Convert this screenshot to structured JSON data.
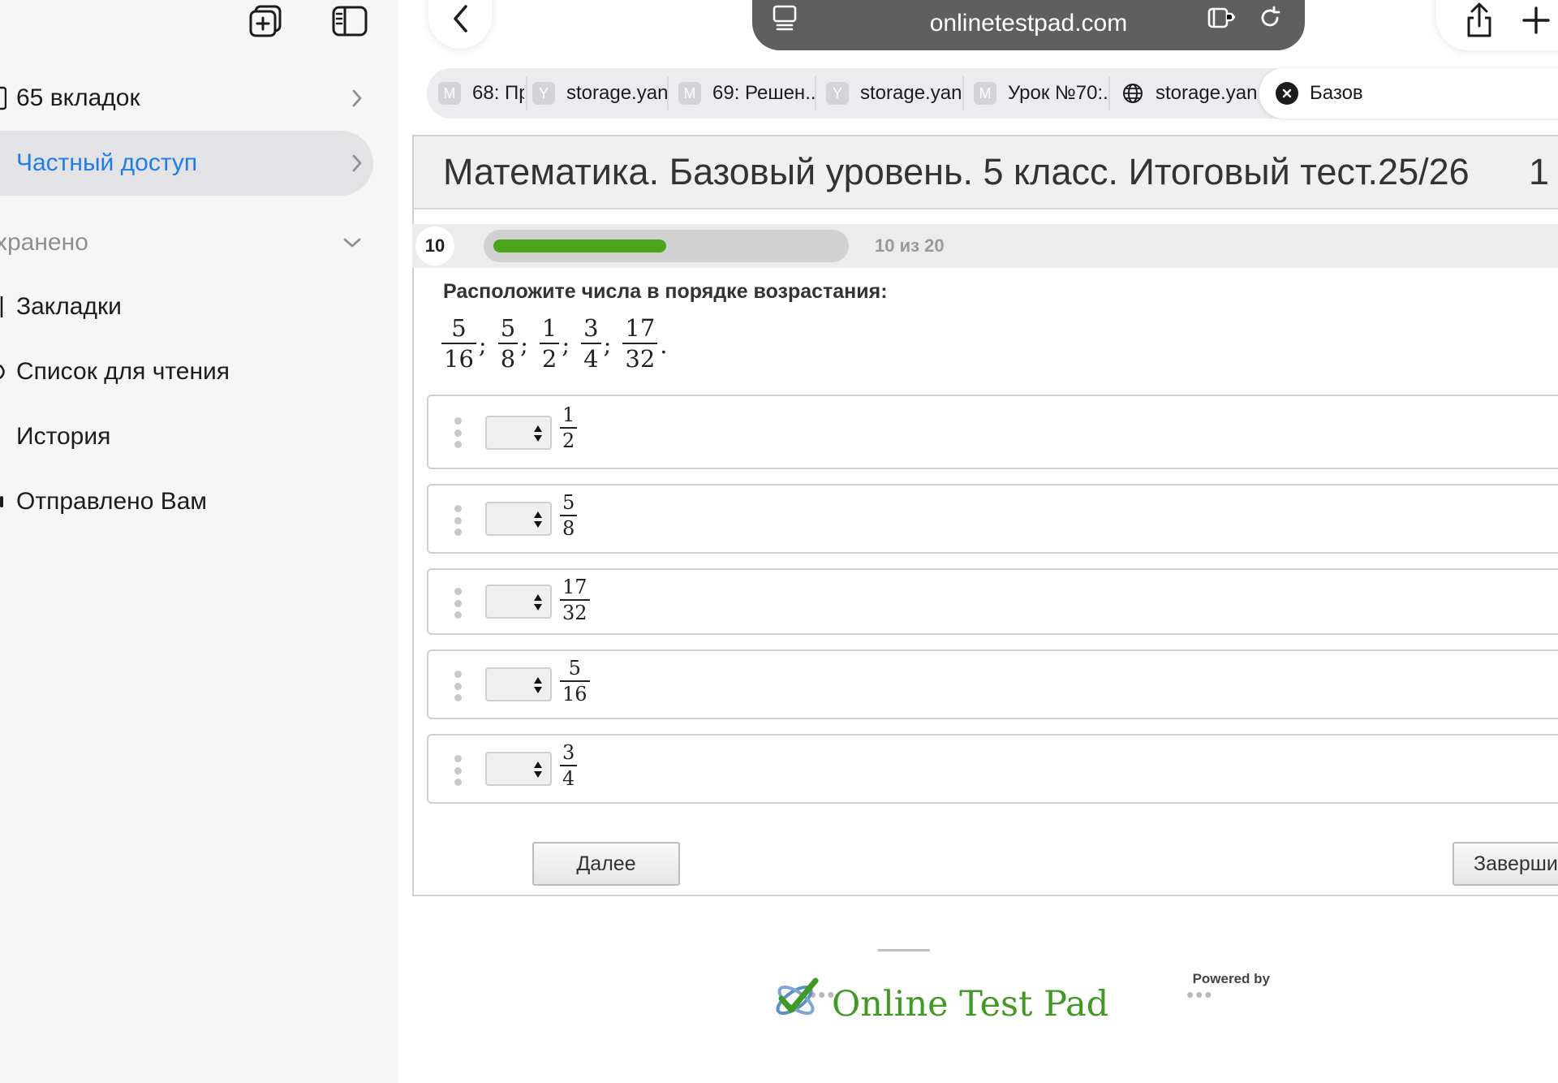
{
  "sidebar": {
    "items": [
      {
        "label": "65 вкладок"
      },
      {
        "label": "Частный доступ"
      },
      {
        "label": "хранено"
      },
      {
        "label": "Закладки"
      },
      {
        "label": "Список для чтения"
      },
      {
        "label": "История"
      },
      {
        "label": "Отправлено Вам"
      }
    ]
  },
  "browser": {
    "url": "onlinetestpad.com",
    "tabs": [
      {
        "favicon": "М",
        "label": "68: Пр"
      },
      {
        "favicon": "Y",
        "label": "storage.yan..."
      },
      {
        "favicon": "М",
        "label": "69: Решен..."
      },
      {
        "favicon": "Y",
        "label": "storage.yan..."
      },
      {
        "favicon": "М",
        "label": "Урок №70:..."
      },
      {
        "favicon": "",
        "label": "storage.yan..."
      },
      {
        "favicon": "",
        "label": "Базов"
      }
    ]
  },
  "test": {
    "title": "Математика. Базовый уровень. 5 класс. Итоговый тест.25/26",
    "title_extra": "1",
    "question_number": "10",
    "progress_text": "10 из 20",
    "progress_fraction": 0.5,
    "question_text": "Расположите числа в порядке возрастания:",
    "given_numbers": [
      {
        "num": "5",
        "den": "16",
        "sep": ";"
      },
      {
        "num": "5",
        "den": "8",
        "sep": ";"
      },
      {
        "num": "1",
        "den": "2",
        "sep": ";"
      },
      {
        "num": "3",
        "den": "4",
        "sep": ";"
      },
      {
        "num": "17",
        "den": "32",
        "sep": "."
      }
    ],
    "answers": [
      {
        "num": "1",
        "den": "2"
      },
      {
        "num": "5",
        "den": "8"
      },
      {
        "num": "17",
        "den": "32"
      },
      {
        "num": "5",
        "den": "16"
      },
      {
        "num": "3",
        "den": "4"
      }
    ],
    "next_button": "Далее",
    "finish_button": "Заверши"
  },
  "footer": {
    "powered_by": "Powered by",
    "brand": "Online Test Pad"
  },
  "colors": {
    "accent": "#1e7cf2",
    "progress": "#4ba51a",
    "brand": "#3f9a22"
  }
}
